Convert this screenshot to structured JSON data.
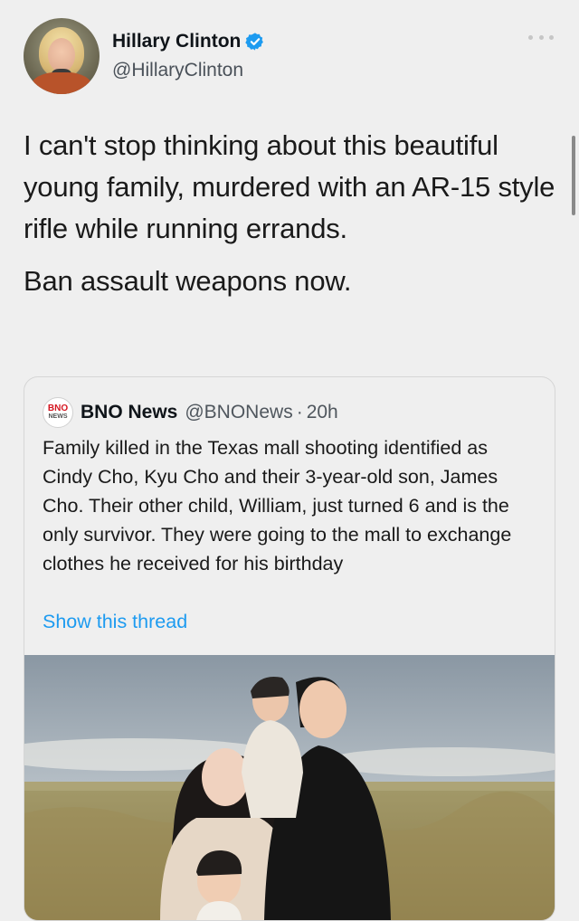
{
  "author": {
    "name": "Hillary Clinton",
    "handle": "@HillaryClinton",
    "verified": true
  },
  "icons": {
    "more": "more-horizontal-icon",
    "verified": "verified-badge-icon"
  },
  "colors": {
    "link": "#1d9bf0",
    "verified": "#1d9bf0",
    "background": "#efefef"
  },
  "tweet": {
    "paragraph1": "I can't stop thinking about this beautiful young family, murdered with an AR-15 style rifle while running errands.",
    "paragraph2": "Ban assault weapons now."
  },
  "quoted": {
    "logo_top": "BNO",
    "logo_bottom": "NEWS",
    "name": "BNO News",
    "handle": "@BNONews",
    "separator": "·",
    "time": "20h",
    "text": "Family killed in the Texas mall shooting identified as Cindy Cho, Kyu Cho and their 3-year-old son, James Cho. Their other child, William, just turned 6 and is the only survivor. They were going to the mall to exchange clothes he received for his birthday",
    "show_thread": "Show this thread"
  }
}
